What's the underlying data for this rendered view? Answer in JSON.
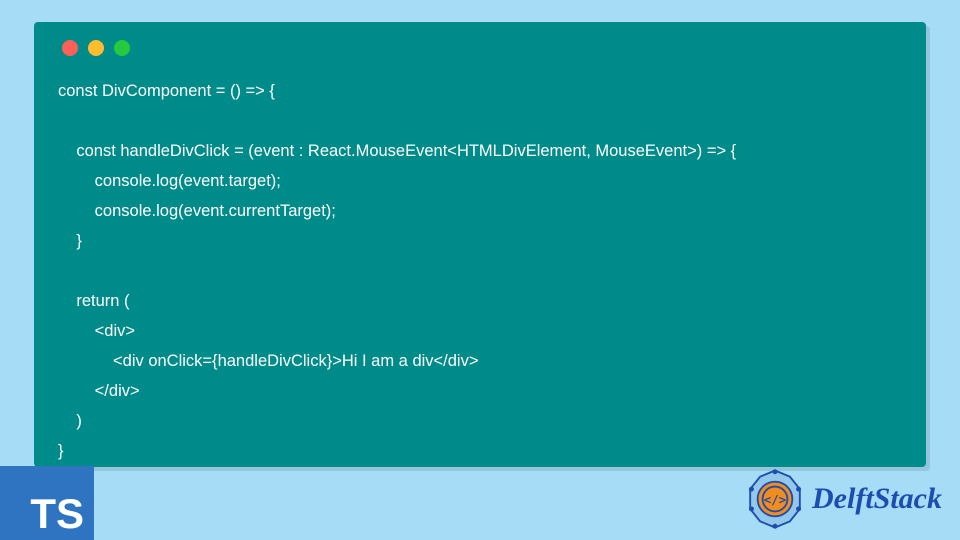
{
  "code": {
    "lines": [
      "const DivComponent = () => {",
      "",
      "    const handleDivClick = (event : React.MouseEvent<HTMLDivElement, MouseEvent>) => {",
      "        console.log(event.target);",
      "        console.log(event.currentTarget);",
      "    }",
      "",
      "    return (",
      "        <div>",
      "            <div onClick={handleDivClick}>Hi I am a div</div>",
      "        </div>",
      "    )",
      "}"
    ]
  },
  "badge": {
    "label": "TS"
  },
  "brand": {
    "name": "DelftStack"
  },
  "colors": {
    "page_bg": "#a6dcf5",
    "window_bg": "#008b8b",
    "code_text": "#ffffff",
    "ts_badge_bg": "#2f74c0",
    "brand_text": "#1c4db0",
    "traffic_red": "#ff5f56",
    "traffic_yellow": "#ffbd2e",
    "traffic_green": "#27c93f"
  }
}
